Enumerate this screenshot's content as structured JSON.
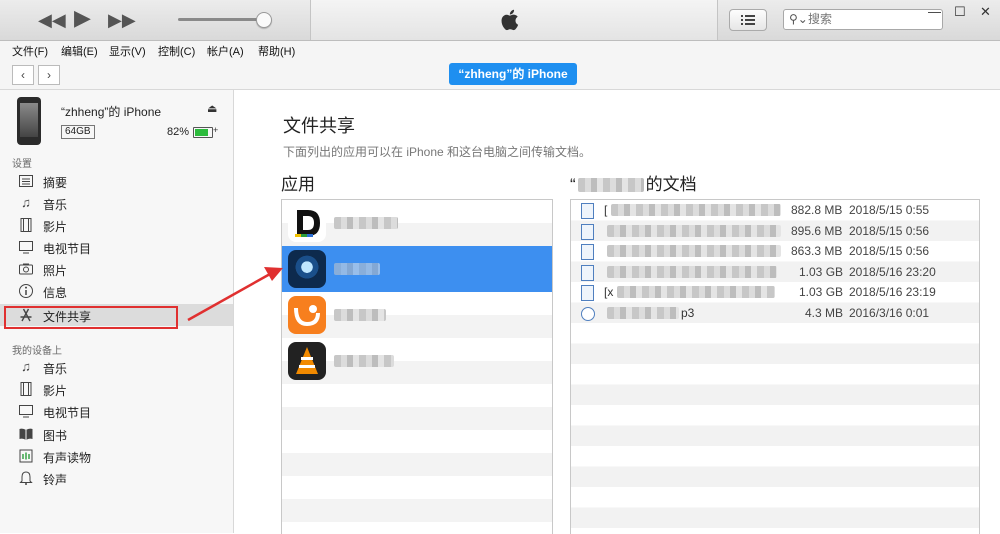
{
  "window": {
    "search_placeholder": "搜索",
    "controls": {
      "minimize": "—",
      "maximize": "☐",
      "close": "✕"
    }
  },
  "menu": [
    "文件(F)",
    "编辑(E)",
    "显示(V)",
    "控制(C)",
    "帐户(A)",
    "帮助(H)"
  ],
  "device_tab": "“zhheng”的 iPhone",
  "device": {
    "name": "“zhheng”的 iPhone",
    "capacity": "64GB",
    "battery": "82%",
    "battery_level": 0.82
  },
  "sidebar": {
    "settings_header": "设置",
    "settings": [
      {
        "label": "摘要",
        "icon": "summary-icon"
      },
      {
        "label": "音乐",
        "icon": "music-icon"
      },
      {
        "label": "影片",
        "icon": "film-icon"
      },
      {
        "label": "电视节目",
        "icon": "tv-icon"
      },
      {
        "label": "照片",
        "icon": "camera-icon"
      },
      {
        "label": "信息",
        "icon": "info-icon"
      },
      {
        "label": "文件共享",
        "icon": "app-store-icon",
        "selected": true
      }
    ],
    "on_device_header": "我的设备上",
    "on_device": [
      {
        "label": "音乐",
        "icon": "music-icon"
      },
      {
        "label": "影片",
        "icon": "film-icon"
      },
      {
        "label": "电视节目",
        "icon": "tv-icon"
      },
      {
        "label": "图书",
        "icon": "book-icon"
      },
      {
        "label": "有声读物",
        "icon": "audiobook-icon"
      },
      {
        "label": "铃声",
        "icon": "bell-icon"
      }
    ]
  },
  "main": {
    "title": "文件共享",
    "subtitle": "下面列出的应用可以在 iPhone 和这台电脑之间传输文档。",
    "apps_header": "应用",
    "docs_header_prefix": "“",
    "docs_header_suffix": "的文档"
  },
  "documents": [
    {
      "name_prefix": "[",
      "name_suffix": "",
      "size": "882.8 MB",
      "date": "2018/5/15 0:55",
      "icon": "video-file-icon"
    },
    {
      "name_prefix": "",
      "name_suffix": "",
      "size": "895.6 MB",
      "date": "2018/5/15 0:56",
      "icon": "video-file-icon"
    },
    {
      "name_prefix": "",
      "name_suffix": "",
      "size": "863.3 MB",
      "date": "2018/5/15 0:56",
      "icon": "video-file-icon"
    },
    {
      "name_prefix": "",
      "name_suffix": "",
      "size": "1.03 GB",
      "date": "2018/5/16 23:20",
      "icon": "video-file-icon"
    },
    {
      "name_prefix": "[x",
      "name_suffix": "",
      "size": "1.03 GB",
      "date": "2018/5/16 23:19",
      "icon": "video-file-icon"
    },
    {
      "name_prefix": "",
      "name_suffix": "p3",
      "size": "4.3 MB",
      "date": "2016/3/16 0:01",
      "icon": "audio-file-icon"
    }
  ]
}
